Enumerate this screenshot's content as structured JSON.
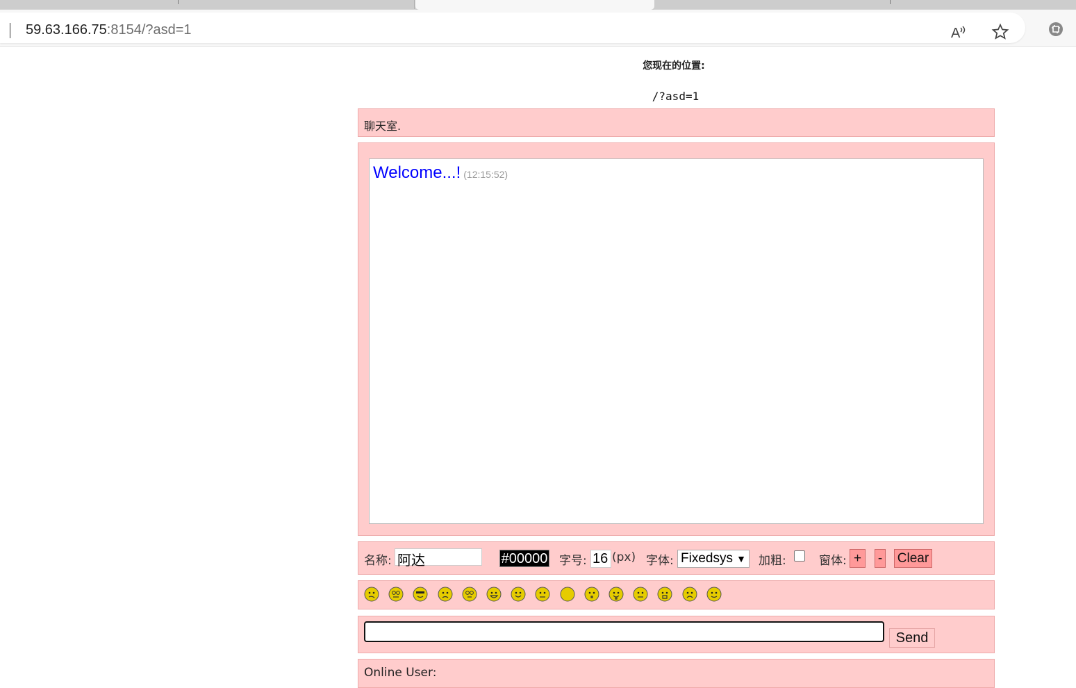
{
  "browser": {
    "url_host": "59.63.166.75",
    "url_rest": ":8154/?asd=1",
    "icons": [
      "read-aloud-icon",
      "favorite-star-icon",
      "extension-icon"
    ]
  },
  "page": {
    "location_label": "您现在的位置:",
    "location_path": "/?asd=1",
    "room_title": "聊天室."
  },
  "chat": {
    "messages": [
      {
        "text": "Welcome...!",
        "time": "(12:15:52)",
        "color": "#0000ff"
      }
    ]
  },
  "controls": {
    "name_label": "名称:",
    "name_value": "阿达",
    "color_value": "#00000",
    "size_label": "字号:",
    "size_value": "16",
    "size_unit": "(px)",
    "font_label": "字体:",
    "font_value": "Fixedsys",
    "bold_label": "加粗:",
    "bold_checked": false,
    "window_label": "窗体:",
    "plus_label": "+",
    "minus_label": "-",
    "clear_label": "Clear"
  },
  "emoticons": [
    "confused",
    "nerd",
    "cool",
    "angry",
    "eye-roll",
    "grin",
    "smile",
    "meh",
    "blank",
    "surprised",
    "tongue",
    "neutral",
    "shock",
    "sad",
    "wink"
  ],
  "composer": {
    "send_label": "Send",
    "message_value": ""
  },
  "online": {
    "label": "Online User:"
  },
  "colors": {
    "panel_bg": "#ffcccc",
    "button_bg": "#ff9999",
    "emoticon": "#e6cc00"
  }
}
